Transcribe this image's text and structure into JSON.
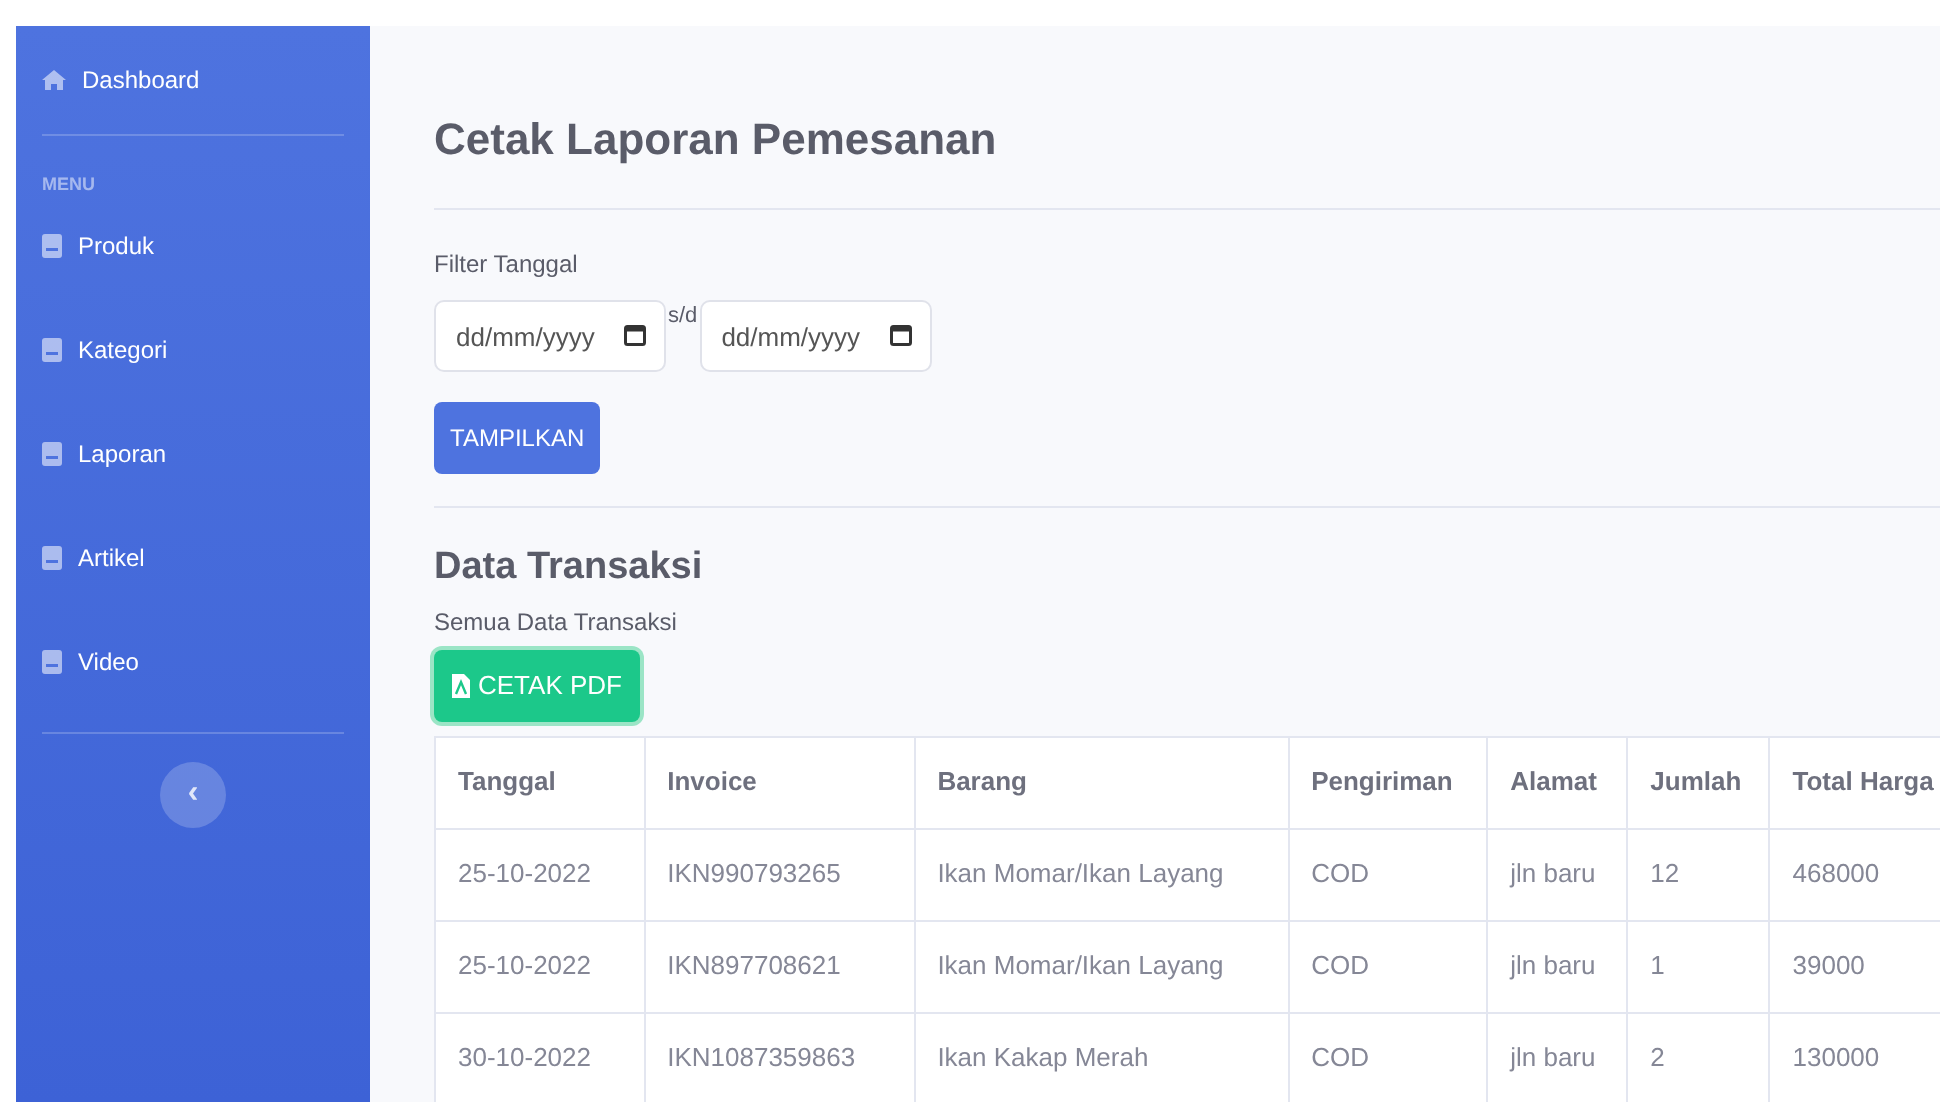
{
  "sidebar": {
    "top_item": {
      "label": "Dashboard"
    },
    "heading": "MENU",
    "items": [
      {
        "label": "Produk"
      },
      {
        "label": "Kategori"
      },
      {
        "label": "Laporan"
      },
      {
        "label": "Artikel"
      },
      {
        "label": "Video"
      }
    ],
    "toggle": "‹"
  },
  "page_title": "Cetak Laporan Pemesanan",
  "filter": {
    "label": "Filter Tanggal",
    "from": {
      "placeholder": "dd/mm/yyyy"
    },
    "separator": "s/d",
    "to": {
      "placeholder": "dd/mm/yyyy"
    },
    "button": "TAMPILKAN"
  },
  "section": {
    "title": "Data Transaksi",
    "subtitle": "Semua Data Transaksi",
    "print_button": "CETAK PDF"
  },
  "table": {
    "columns": [
      "Tanggal",
      "Invoice",
      "Barang",
      "Pengiriman",
      "Alamat",
      "Jumlah",
      "Total Harga"
    ],
    "rows": [
      [
        "25-10-2022",
        "IKN990793265",
        "Ikan Momar/Ikan Layang",
        "COD",
        "jln baru",
        "12",
        "468000"
      ],
      [
        "25-10-2022",
        "IKN897708621",
        "Ikan Momar/Ikan Layang",
        "COD",
        "jln baru",
        "1",
        "39000"
      ],
      [
        "30-10-2022",
        "IKN1087359863",
        "Ikan Kakap Merah",
        "COD",
        "jln baru",
        "2",
        "130000"
      ]
    ]
  }
}
